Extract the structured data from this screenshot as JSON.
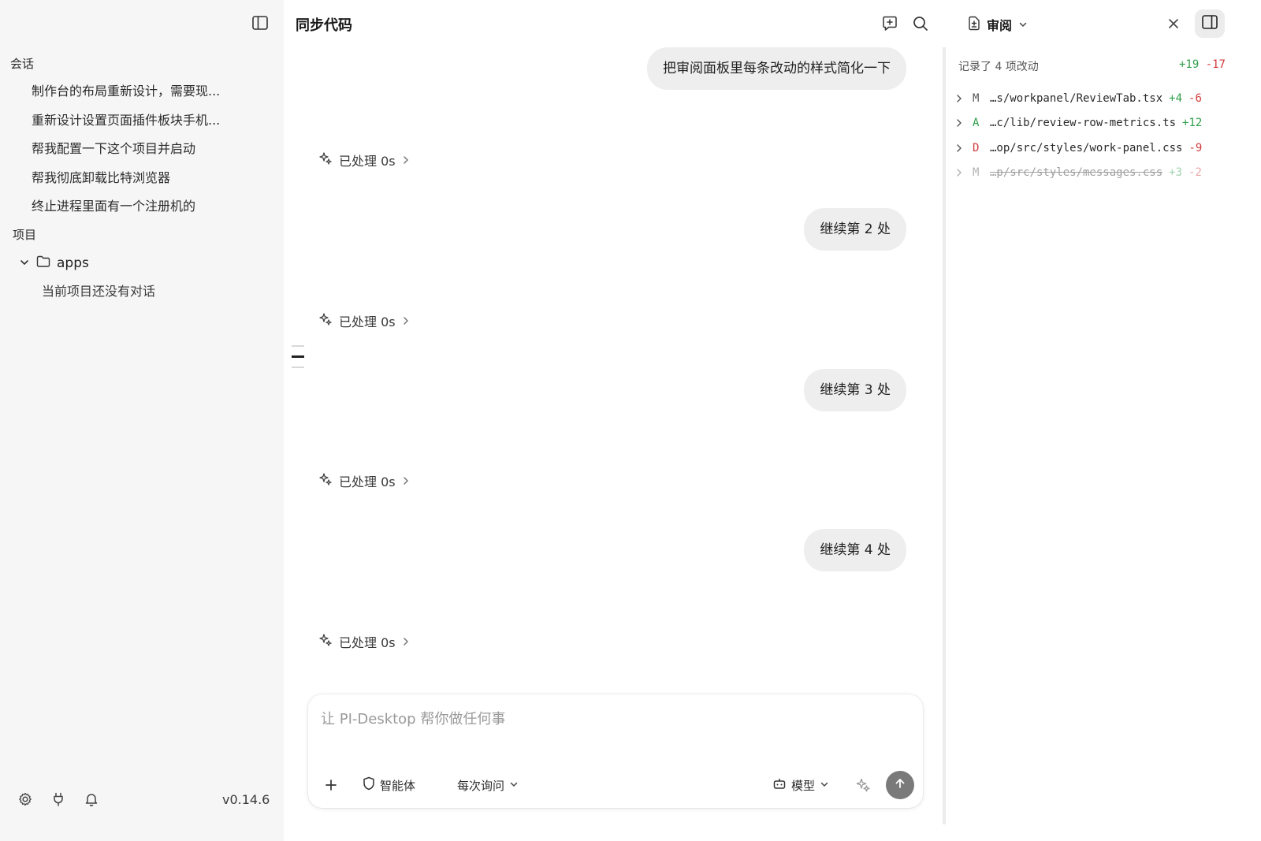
{
  "sidebar": {
    "sessions_label": "会话",
    "sessions": [
      "制作台的布局重新设计，需要现...",
      "重新设计设置页面插件板块手机...",
      "帮我配置一下这个项目并启动",
      "帮我彻底卸载比特浏览器",
      "终止进程里面有一个注册机的"
    ],
    "projects_label": "项目",
    "project_name": "apps",
    "empty_hint": "当前项目还没有对话",
    "version": "v0.14.6"
  },
  "main": {
    "title": "同步代码",
    "messages": [
      {
        "role": "user",
        "text": "把审阅面板里每条改动的样式简化一下"
      },
      {
        "role": "assistant",
        "status": "已处理 0s"
      },
      {
        "role": "user",
        "text": "继续第 2 处"
      },
      {
        "role": "assistant",
        "status": "已处理 0s"
      },
      {
        "role": "user",
        "text": "继续第 3 处"
      },
      {
        "role": "assistant",
        "status": "已处理 0s"
      },
      {
        "role": "user",
        "text": "继续第 4 处"
      },
      {
        "role": "assistant",
        "status": "已处理 0s"
      }
    ],
    "composer": {
      "placeholder": "让 PI-Desktop 帮你做任何事",
      "agent_label": "智能体",
      "approval_label": "每次询问",
      "model_label": "模型"
    }
  },
  "review": {
    "tab_label": "审阅",
    "summary": "记录了 4 项改动",
    "total_add": "+19",
    "total_del": "-17",
    "changes": [
      {
        "status": "M",
        "path": "…s/workpanel/ReviewTab.tsx",
        "add": "+4",
        "del": "-6"
      },
      {
        "status": "A",
        "path": "…c/lib/review-row-metrics.ts",
        "add": "+12",
        "del": ""
      },
      {
        "status": "D",
        "path": "…op/src/styles/work-panel.css",
        "add": "",
        "del": "-9"
      },
      {
        "status": "M",
        "path": "…p/src/styles/messages.css",
        "add": "+3",
        "del": "-2"
      }
    ]
  },
  "colors": {
    "addition": "#2e9e4a",
    "deletion": "#d33b3b",
    "sidebar_bg": "#f6f6f6",
    "bubble_bg": "#eeeeee"
  }
}
